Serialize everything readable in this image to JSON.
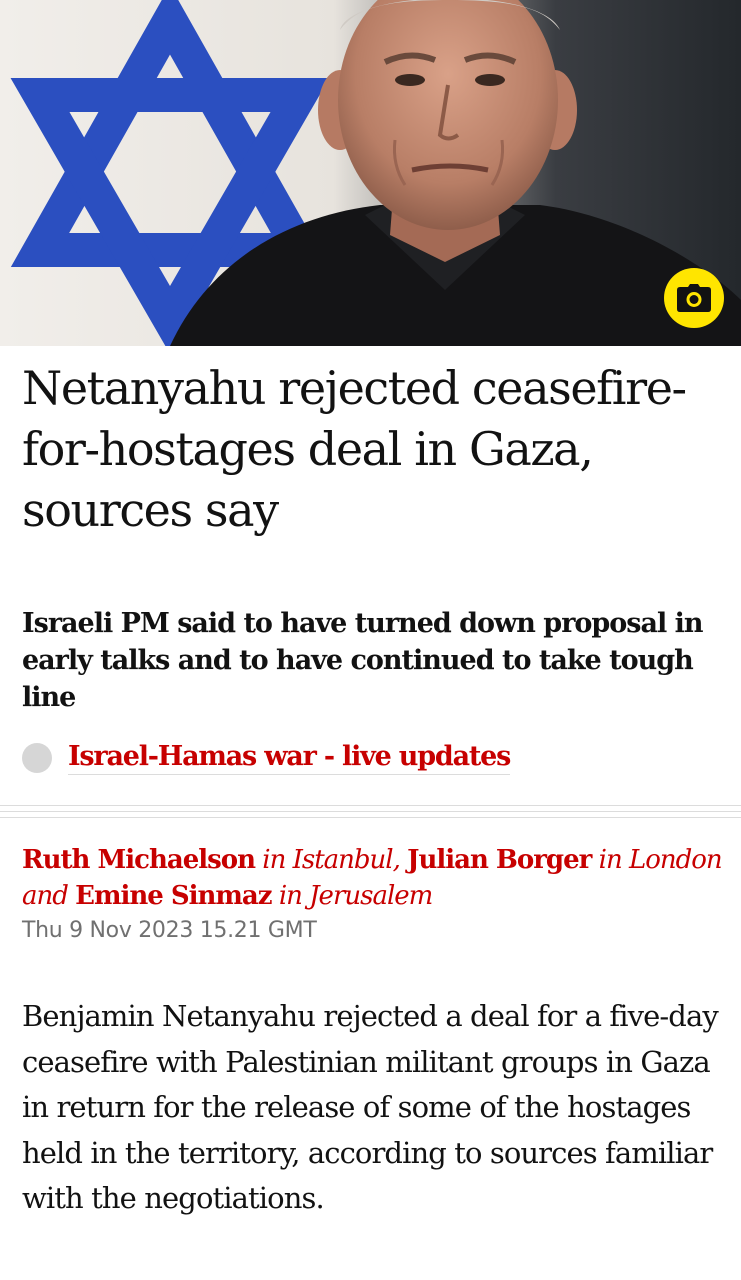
{
  "hero": {
    "camera_icon": "camera-icon",
    "colors": {
      "flag_blue": "#2b4fc0",
      "camera_badge": "#ffe500"
    }
  },
  "article": {
    "headline": "Netanyahu rejected ceasefire-for-hostages deal in Gaza, sources say",
    "standfirst": "Israeli PM said to have turned down proposal in early talks and to have continued to take tough line",
    "live_link": "Israel-Hamas war - live updates",
    "byline": {
      "author1": "Ruth Michaelson",
      "location1": "in Istanbul,",
      "author2": "Julian Borger",
      "location2": "in London and",
      "author3": "Emine Sinmaz",
      "location3": "in Jerusalem"
    },
    "dateline": "Thu 9 Nov 2023 15.21 GMT",
    "body": "Benjamin Netanyahu rejected a deal for a five-day ceasefire with Palestinian militant groups in Gaza in return for the release of some of the hostages held in the territory, according to sources familiar with the negotiations."
  },
  "colors": {
    "accent": "#c70000",
    "text": "#121212",
    "meta": "#707070"
  }
}
